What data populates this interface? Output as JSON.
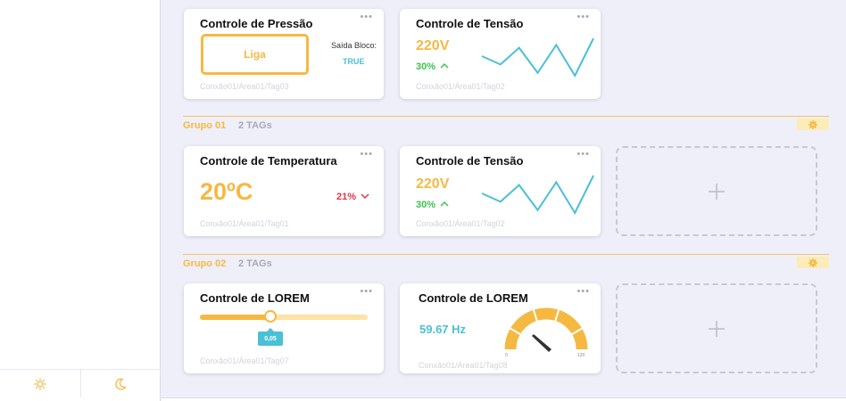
{
  "colors": {
    "accent": "#f5b942",
    "teal": "#4ac0d4",
    "up": "#3ec24f",
    "down": "#e0354a"
  },
  "sidebar": {
    "theme_light_icon": "sun-icon",
    "theme_dark_icon": "moon-icon"
  },
  "top_row": {
    "pressure": {
      "title": "Controle de Pressão",
      "menu": "•••",
      "button_label": "Liga",
      "output_label": "Saída Bloco:",
      "output_value": "TRUE",
      "tag": "Conxão01/Área01/Tag03"
    },
    "voltage": {
      "title": "Controle de Tensão",
      "menu": "•••",
      "value": "220V",
      "change": "30%",
      "trend": "up",
      "sparkline": [
        40,
        55,
        25,
        70,
        20,
        75,
        8
      ],
      "tag": "Conxão01/Área01/Tag02"
    }
  },
  "group1": {
    "name": "Grupo 01",
    "count": "2 TAGs",
    "gear_icon": "gear-icon",
    "temperature": {
      "title": "Controle de Temperatura",
      "menu": "•••",
      "value": "20ºC",
      "change": "21%",
      "trend": "down",
      "tag": "Conxão01/Área01/Tag01"
    },
    "voltage": {
      "title": "Controle de Tensão",
      "menu": "•••",
      "value": "220V",
      "change": "30%",
      "trend": "up",
      "sparkline": [
        40,
        55,
        25,
        70,
        20,
        75,
        8
      ],
      "tag": "Conxão01/Área01/Tag02"
    },
    "add_icon": "plus-icon"
  },
  "group2": {
    "name": "Grupo 02",
    "count": "2 TAGs",
    "gear_icon": "gear-icon",
    "slider": {
      "title": "Controle de LOREM",
      "menu": "•••",
      "value": 0.05,
      "value_label": "0,05",
      "fraction": 0.42,
      "tag": "Conxão01/Área01/Tag07"
    },
    "gauge": {
      "title": "Controle de LOREM",
      "menu": "•••",
      "value_label": "59.67 Hz",
      "value": 59.67,
      "min": "0",
      "max": "120",
      "tag": "Conxão01/Área01/Tag08"
    },
    "add_icon": "plus-icon"
  }
}
